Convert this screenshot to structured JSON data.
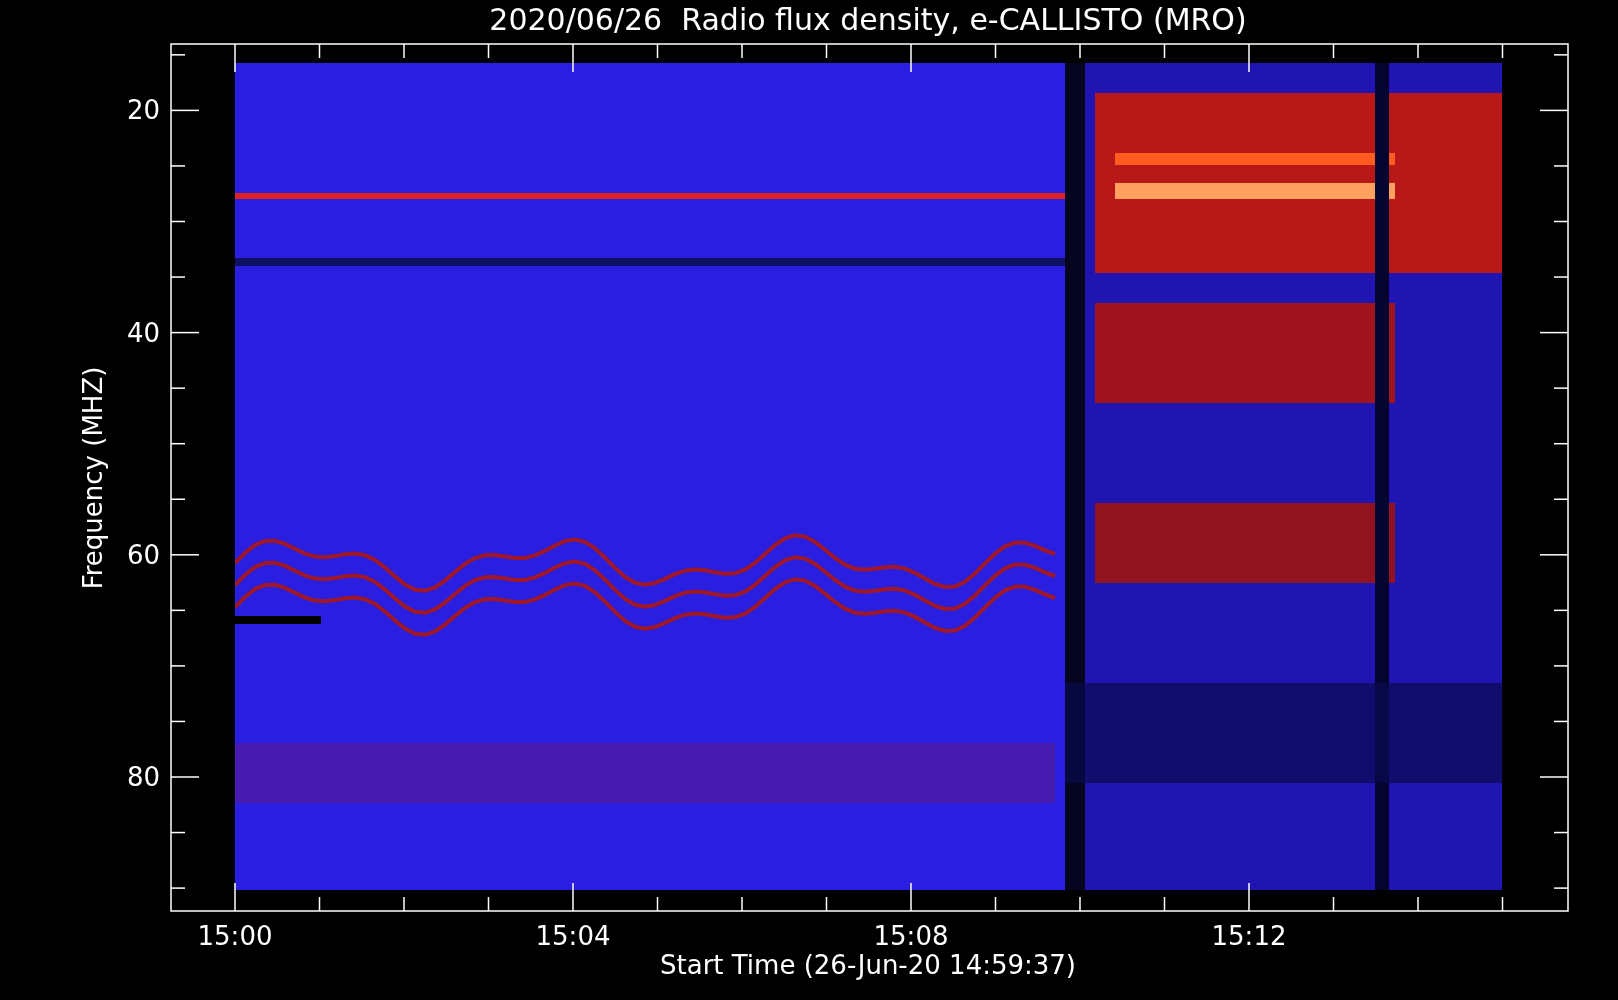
{
  "title": "2020/06/26  Radio flux density, e-CALLISTO (MRO)",
  "y_axis": {
    "label": "Frequency (MHZ)",
    "ticks": [
      "20",
      "40",
      "60",
      "80"
    ]
  },
  "x_axis": {
    "label": "Start Time (26-Jun-20 14:59:37)",
    "ticks": [
      "15:00",
      "15:04",
      "15:08",
      "15:12"
    ]
  }
}
